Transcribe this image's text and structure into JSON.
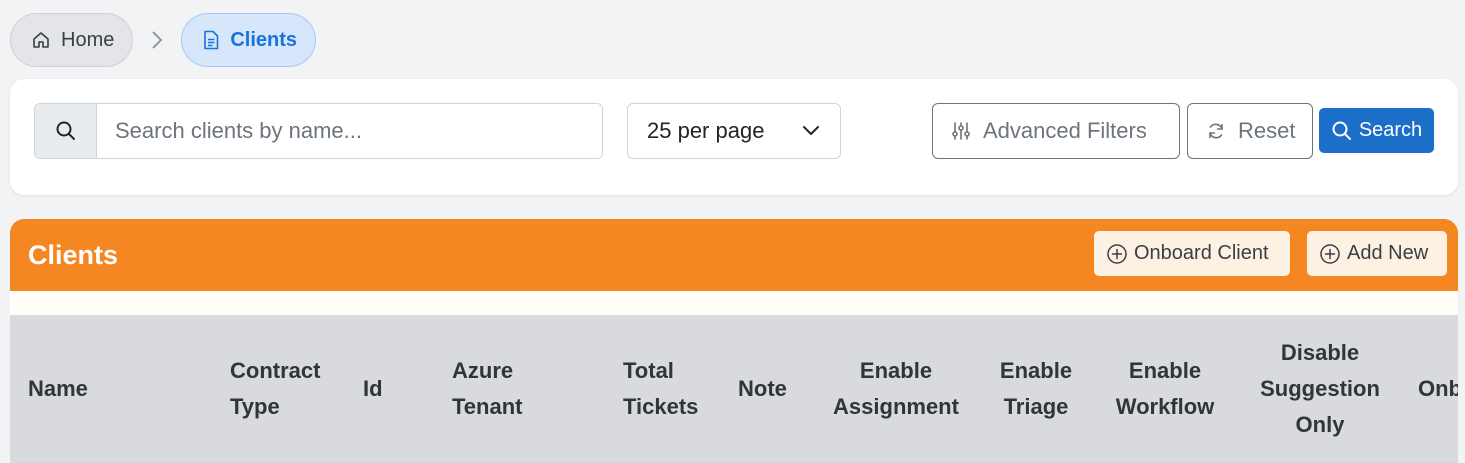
{
  "breadcrumb": {
    "home": "Home",
    "current": "Clients"
  },
  "search": {
    "placeholder": "Search clients by name...",
    "value": "",
    "per_page": "25 per page",
    "advanced_filters": "Advanced Filters",
    "reset": "Reset",
    "search_button": "Search"
  },
  "clients": {
    "title": "Clients",
    "onboard_button": "Onboard Client",
    "add_button": "Add New",
    "columns": [
      {
        "l1": "Name"
      },
      {
        "l1": "Contract",
        "l2": "Type"
      },
      {
        "l1": "Id"
      },
      {
        "l1": "Azure",
        "l2": "Tenant"
      },
      {
        "l1": "Total",
        "l2": "Tickets"
      },
      {
        "l1": "Note"
      },
      {
        "l1": "Enable",
        "l2": "Assignment"
      },
      {
        "l1": "Enable",
        "l2": "Triage"
      },
      {
        "l1": "Enable",
        "l2": "Workflow"
      },
      {
        "l1": "Disable",
        "l2": "Suggestion",
        "l3": "Only"
      },
      {
        "l1": "Onb"
      }
    ]
  },
  "colors": {
    "accent_orange": "#f58722",
    "primary_blue": "#1c6fc9"
  }
}
